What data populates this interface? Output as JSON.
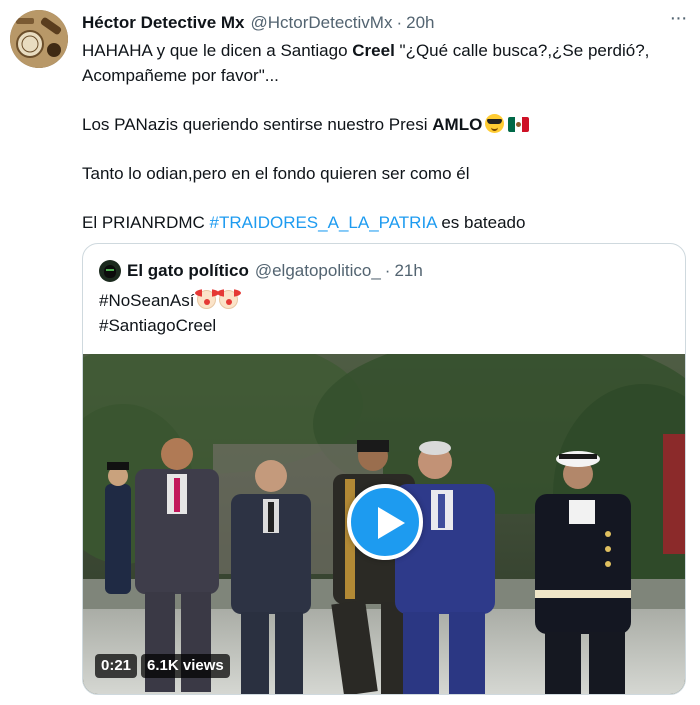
{
  "tweet": {
    "author_name": "Héctor Detective Mx",
    "author_handle": "@HctorDetectivMx",
    "separator": "·",
    "time": "20h",
    "more_icon": "more-horizontal-icon",
    "line1_a": "HAHAHA y que le dicen a Santiago ",
    "line1_bold": "Creel",
    "line1_b": " \"¿Qué calle busca?,¿Se perdió?,",
    "line2": "Acompañeme por favor\"...",
    "line3_a": "Los PANazis queriendo sentirse nuestro Presi ",
    "line3_bold": "AMLO",
    "line3_emojis": [
      "sunglasses-face",
      "mexico-flag"
    ],
    "line4": "Tanto lo odian,pero en el fondo quieren ser como él",
    "line5_a": "El PRIANRDMC ",
    "line5_hashtag": "#TRAIDORES_A_LA_PATRIA",
    "line5_b": " es bateado"
  },
  "quote": {
    "author_name": "El gato político",
    "author_handle": "@elgatopolitico_",
    "separator": "·",
    "time": "21h",
    "line1": "#NoSeanAsí",
    "line1_emojis": [
      "clown-face",
      "clown-face"
    ],
    "line2": "#SantiagoCreel",
    "video": {
      "duration": "0:21",
      "views": "6.1K views",
      "play_icon": "play-icon",
      "accent": "#1d9bf0"
    }
  },
  "colors": {
    "text": "#0f1419",
    "secondary": "#536471",
    "link": "#1d9bf0",
    "border": "#cfd9de"
  }
}
